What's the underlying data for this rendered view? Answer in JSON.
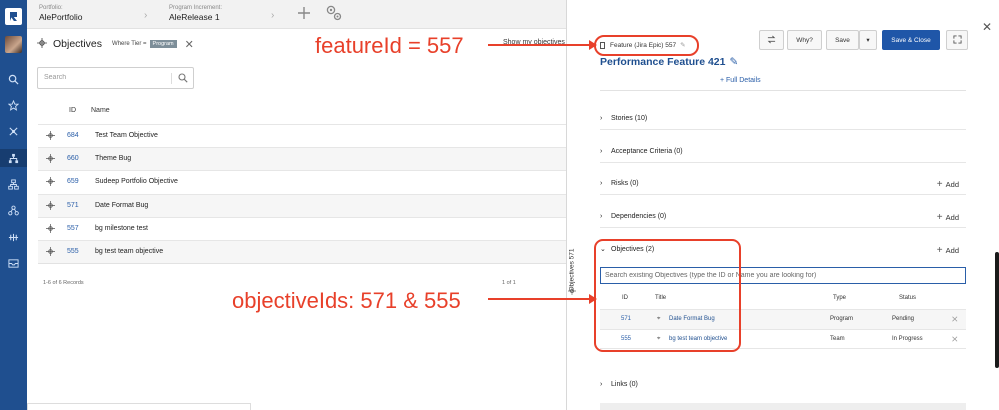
{
  "breadcrumb": {
    "portfolio_label": "Portfolio:",
    "portfolio_value": "AlePortfolio",
    "pi_label": "Program Increment:",
    "pi_value": "AleRelease 1"
  },
  "objectives_panel": {
    "title": "Objectives",
    "where_label": "Where Tier =",
    "tier_badge": "Program",
    "show_my": "Show my objectives",
    "search_placeholder": "Search",
    "columns": {
      "id": "ID",
      "name": "Name"
    },
    "rows": [
      {
        "id": "684",
        "name": "Test Team Objective"
      },
      {
        "id": "660",
        "name": "Theme Bug"
      },
      {
        "id": "659",
        "name": "Sudeep Portfolio Objective"
      },
      {
        "id": "571",
        "name": "Date Format Bug"
      },
      {
        "id": "557",
        "name": "bg milestone test"
      },
      {
        "id": "555",
        "name": "bg test team objective"
      }
    ],
    "records": "1-6 of 6 Records",
    "pager": "1 of 1"
  },
  "side_tab_label": "Objectives 571",
  "detail": {
    "feature_tag": "Feature (Jira Epic) 557",
    "title": "Performance Feature 421",
    "full_details": "+ Full Details",
    "buttons": {
      "why": "Why?",
      "save": "Save",
      "save_close": "Save & Close"
    },
    "sections": {
      "stories": "Stories (10)",
      "acceptance": "Acceptance Criteria (0)",
      "risks": "Risks (0)",
      "dependencies": "Dependencies (0)",
      "objectives": "Objectives (2)",
      "links": "Links (0)"
    },
    "add_label": "Add",
    "objective_search_placeholder": "Search existing Objectives (type the ID or Name you are looking for)",
    "sub_columns": {
      "id": "ID",
      "title": "Title",
      "type": "Type",
      "status": "Status"
    },
    "sub_rows": [
      {
        "id": "571",
        "title": "Date Format Bug",
        "type": "Program",
        "status": "Pending"
      },
      {
        "id": "555",
        "title": "bg test team objective",
        "type": "Team",
        "status": "In Progress"
      }
    ]
  },
  "annotations": {
    "feature": "featureId = 557",
    "objectives": "objectiveIds: 571 & 555",
    "color": "#e8402a"
  },
  "colors": {
    "rail": "#1f4f8f",
    "primary_button": "#1f56a8",
    "link": "#2a5ea8"
  }
}
